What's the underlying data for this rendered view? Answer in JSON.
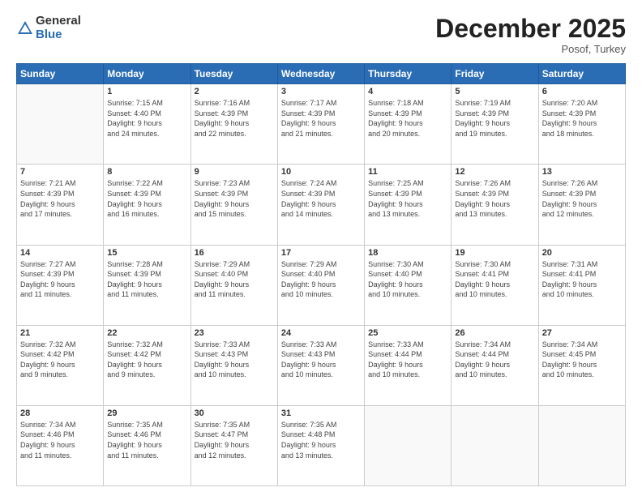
{
  "logo": {
    "general": "General",
    "blue": "Blue"
  },
  "title": "December 2025",
  "location": "Posof, Turkey",
  "days_header": [
    "Sunday",
    "Monday",
    "Tuesday",
    "Wednesday",
    "Thursday",
    "Friday",
    "Saturday"
  ],
  "weeks": [
    [
      {
        "day": "",
        "info": ""
      },
      {
        "day": "1",
        "info": "Sunrise: 7:15 AM\nSunset: 4:40 PM\nDaylight: 9 hours\nand 24 minutes."
      },
      {
        "day": "2",
        "info": "Sunrise: 7:16 AM\nSunset: 4:39 PM\nDaylight: 9 hours\nand 22 minutes."
      },
      {
        "day": "3",
        "info": "Sunrise: 7:17 AM\nSunset: 4:39 PM\nDaylight: 9 hours\nand 21 minutes."
      },
      {
        "day": "4",
        "info": "Sunrise: 7:18 AM\nSunset: 4:39 PM\nDaylight: 9 hours\nand 20 minutes."
      },
      {
        "day": "5",
        "info": "Sunrise: 7:19 AM\nSunset: 4:39 PM\nDaylight: 9 hours\nand 19 minutes."
      },
      {
        "day": "6",
        "info": "Sunrise: 7:20 AM\nSunset: 4:39 PM\nDaylight: 9 hours\nand 18 minutes."
      }
    ],
    [
      {
        "day": "7",
        "info": "Sunrise: 7:21 AM\nSunset: 4:39 PM\nDaylight: 9 hours\nand 17 minutes."
      },
      {
        "day": "8",
        "info": "Sunrise: 7:22 AM\nSunset: 4:39 PM\nDaylight: 9 hours\nand 16 minutes."
      },
      {
        "day": "9",
        "info": "Sunrise: 7:23 AM\nSunset: 4:39 PM\nDaylight: 9 hours\nand 15 minutes."
      },
      {
        "day": "10",
        "info": "Sunrise: 7:24 AM\nSunset: 4:39 PM\nDaylight: 9 hours\nand 14 minutes."
      },
      {
        "day": "11",
        "info": "Sunrise: 7:25 AM\nSunset: 4:39 PM\nDaylight: 9 hours\nand 13 minutes."
      },
      {
        "day": "12",
        "info": "Sunrise: 7:26 AM\nSunset: 4:39 PM\nDaylight: 9 hours\nand 13 minutes."
      },
      {
        "day": "13",
        "info": "Sunrise: 7:26 AM\nSunset: 4:39 PM\nDaylight: 9 hours\nand 12 minutes."
      }
    ],
    [
      {
        "day": "14",
        "info": "Sunrise: 7:27 AM\nSunset: 4:39 PM\nDaylight: 9 hours\nand 11 minutes."
      },
      {
        "day": "15",
        "info": "Sunrise: 7:28 AM\nSunset: 4:39 PM\nDaylight: 9 hours\nand 11 minutes."
      },
      {
        "day": "16",
        "info": "Sunrise: 7:29 AM\nSunset: 4:40 PM\nDaylight: 9 hours\nand 11 minutes."
      },
      {
        "day": "17",
        "info": "Sunrise: 7:29 AM\nSunset: 4:40 PM\nDaylight: 9 hours\nand 10 minutes."
      },
      {
        "day": "18",
        "info": "Sunrise: 7:30 AM\nSunset: 4:40 PM\nDaylight: 9 hours\nand 10 minutes."
      },
      {
        "day": "19",
        "info": "Sunrise: 7:30 AM\nSunset: 4:41 PM\nDaylight: 9 hours\nand 10 minutes."
      },
      {
        "day": "20",
        "info": "Sunrise: 7:31 AM\nSunset: 4:41 PM\nDaylight: 9 hours\nand 10 minutes."
      }
    ],
    [
      {
        "day": "21",
        "info": "Sunrise: 7:32 AM\nSunset: 4:42 PM\nDaylight: 9 hours\nand 9 minutes."
      },
      {
        "day": "22",
        "info": "Sunrise: 7:32 AM\nSunset: 4:42 PM\nDaylight: 9 hours\nand 9 minutes."
      },
      {
        "day": "23",
        "info": "Sunrise: 7:33 AM\nSunset: 4:43 PM\nDaylight: 9 hours\nand 10 minutes."
      },
      {
        "day": "24",
        "info": "Sunrise: 7:33 AM\nSunset: 4:43 PM\nDaylight: 9 hours\nand 10 minutes."
      },
      {
        "day": "25",
        "info": "Sunrise: 7:33 AM\nSunset: 4:44 PM\nDaylight: 9 hours\nand 10 minutes."
      },
      {
        "day": "26",
        "info": "Sunrise: 7:34 AM\nSunset: 4:44 PM\nDaylight: 9 hours\nand 10 minutes."
      },
      {
        "day": "27",
        "info": "Sunrise: 7:34 AM\nSunset: 4:45 PM\nDaylight: 9 hours\nand 10 minutes."
      }
    ],
    [
      {
        "day": "28",
        "info": "Sunrise: 7:34 AM\nSunset: 4:46 PM\nDaylight: 9 hours\nand 11 minutes."
      },
      {
        "day": "29",
        "info": "Sunrise: 7:35 AM\nSunset: 4:46 PM\nDaylight: 9 hours\nand 11 minutes."
      },
      {
        "day": "30",
        "info": "Sunrise: 7:35 AM\nSunset: 4:47 PM\nDaylight: 9 hours\nand 12 minutes."
      },
      {
        "day": "31",
        "info": "Sunrise: 7:35 AM\nSunset: 4:48 PM\nDaylight: 9 hours\nand 13 minutes."
      },
      {
        "day": "",
        "info": ""
      },
      {
        "day": "",
        "info": ""
      },
      {
        "day": "",
        "info": ""
      }
    ]
  ]
}
